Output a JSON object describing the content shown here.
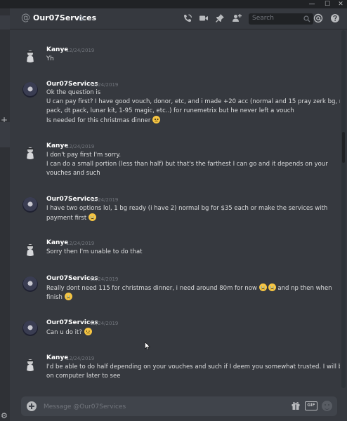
{
  "window": {
    "min": "—",
    "max": "☐",
    "close": "✕"
  },
  "sidebar": {
    "add_glyph": "+",
    "settings_glyph": "⚙"
  },
  "header": {
    "at_glyph": "@",
    "channel_name": "Our07Services",
    "search_placeholder": "Search",
    "icons": [
      "call-icon",
      "video-icon",
      "pin-icon",
      "add-user-icon",
      "search-icon",
      "mention-icon",
      "help-icon"
    ]
  },
  "messages": [
    {
      "user": "Kanye",
      "time": "12/24/2019",
      "avatar": "kanye",
      "lines": [
        "Yh"
      ]
    },
    {
      "user": "Our07Services",
      "time": "12/24/2019",
      "avatar": "ours",
      "lines": [
        "Ok the question is",
        "U can pay first? I have good vouch, donor, etc, and i made +20 acc (normal and 15 pray zerk bg, nmz",
        "pack, dt pack, lunar kit, 1-95 magic, etc..) for runemetrix but he never left a vouch",
        "Is needed for this christmas dinner"
      ]
    },
    {
      "user": "Kanye",
      "time": "12/24/2019",
      "avatar": "kanye",
      "lines": [
        "I don't pay first I'm sorry.",
        "I can do a small portion (less than half) but that's the farthest I can go and it depends on your",
        "vouches and such"
      ]
    },
    {
      "user": "Our07Services",
      "time": "12/24/2019",
      "avatar": "ours",
      "lines": [
        "I have two options lol, 1 bg ready (i have 2) normal bg for $35 each or make the services with",
        "payment first"
      ]
    },
    {
      "user": "Kanye",
      "time": "12/24/2019",
      "avatar": "kanye",
      "lines": [
        "Sorry then I'm unable to do that"
      ]
    },
    {
      "user": "Our07Services",
      "time": "12/24/2019",
      "avatar": "ours",
      "lines": [
        "Really dont need 115 for christmas dinner, i need around 80m for now",
        "and np then when",
        "finish"
      ]
    },
    {
      "user": "Our07Services",
      "time": "12/24/2019",
      "avatar": "ours",
      "lines": [
        "Can u do it?"
      ]
    },
    {
      "user": "Kanye",
      "time": "12/24/2019",
      "avatar": "kanye",
      "lines": [
        "I'd be able to do half depending on your vouches and such if I deem you somewhat trusted. I will be",
        "on computer later to see"
      ]
    }
  ],
  "composer": {
    "placeholder": "Message @Our07Services",
    "gif_label": "GIF"
  }
}
